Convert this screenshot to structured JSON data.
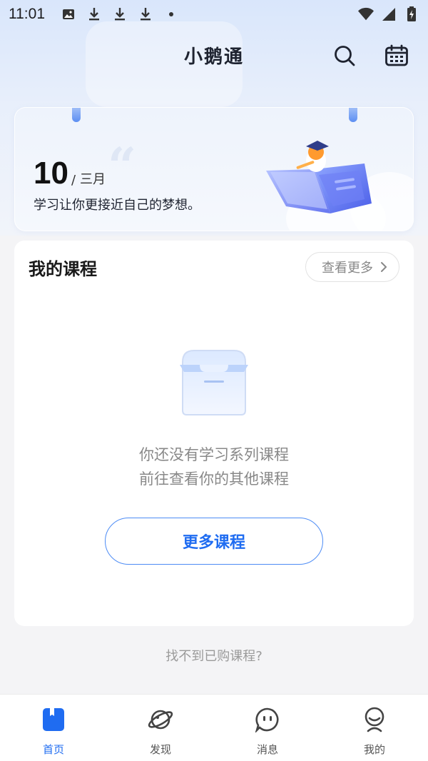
{
  "status_bar": {
    "time": "11:01"
  },
  "header": {
    "title": "小鹅通"
  },
  "banner": {
    "day": "10",
    "separator": "/",
    "month": "三月",
    "motto": "学习让你更接近自己的梦想。"
  },
  "courses": {
    "title": "我的课程",
    "view_more": "查看更多",
    "empty_line1": "你还没有学习系列课程",
    "empty_line2": "前往查看你的其他课程",
    "more_button": "更多课程"
  },
  "cant_find": "找不到已购课程?",
  "nav": {
    "items": [
      {
        "label": "首页",
        "icon": "home-book-icon",
        "active": true
      },
      {
        "label": "发现",
        "icon": "planet-icon",
        "active": false
      },
      {
        "label": "消息",
        "icon": "message-face-icon",
        "active": false
      },
      {
        "label": "我的",
        "icon": "profile-icon",
        "active": false
      }
    ]
  },
  "colors": {
    "accent": "#1f6cf1",
    "text_primary": "#1a1a1a",
    "text_muted": "#888888"
  }
}
